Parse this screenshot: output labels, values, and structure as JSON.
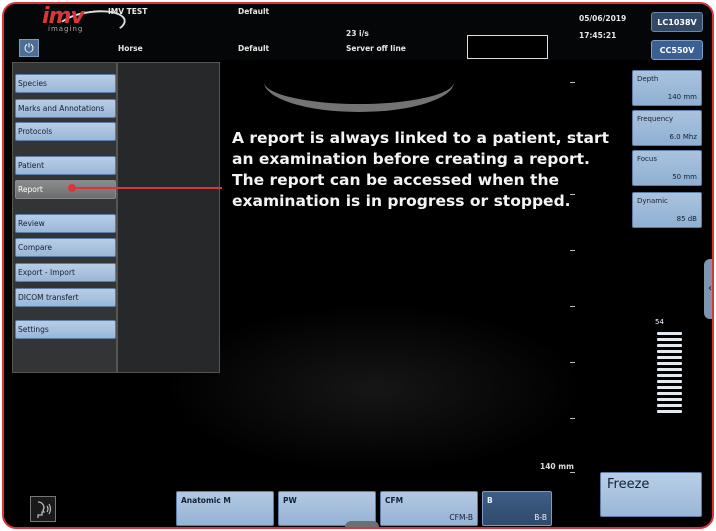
{
  "header": {
    "brand": "imv",
    "brand_sub": "imaging",
    "title": "IMV TEST",
    "animal": "Horse",
    "preset_top": "Default",
    "preset_bottom": "Default",
    "frame_rate": "23 i/s",
    "server_status": "Server off line",
    "date": "05/06/2019",
    "time": "17:45:21",
    "probes": [
      "LC1038V",
      "CC550V"
    ]
  },
  "menu": {
    "items": [
      {
        "label": "Species"
      },
      {
        "label": "Marks and Annotations"
      },
      {
        "label": "Protocols"
      },
      {
        "label": "Patient"
      },
      {
        "label": "Report"
      },
      {
        "label": "Review"
      },
      {
        "label": "Compare"
      },
      {
        "label": "Export - Import"
      },
      {
        "label": "DICOM transfert"
      },
      {
        "label": "Settings"
      }
    ],
    "active": "Report"
  },
  "callout": {
    "text": "A report is always linked to a patient, start an examination before creating a report. The report can be accessed when the examination is in progress or stopped."
  },
  "scan": {
    "depth_label": "140 mm"
  },
  "params": [
    {
      "name": "Depth",
      "value": "140 mm"
    },
    {
      "name": "Frequency",
      "value": "6.0 Mhz"
    },
    {
      "name": "Focus",
      "value": "50 mm"
    },
    {
      "name": "Dynamic",
      "value": "85 dB"
    }
  ],
  "gain": {
    "value": "54"
  },
  "bottom": {
    "modes": [
      {
        "label": "Anatomic M",
        "sub": ""
      },
      {
        "label": "PW",
        "sub": ""
      },
      {
        "label": "CFM",
        "sub": "CFM-B"
      },
      {
        "label": "B",
        "sub": "B-B"
      }
    ],
    "freeze_label": "Freeze"
  },
  "colors": {
    "accent": "#d9363c",
    "button": "#9ab7d8",
    "active_mode": "#2f4a6b"
  },
  "icons": {
    "power": "power-icon",
    "voice": "voice-command-icon",
    "chevron": "chevron-up-icon"
  }
}
